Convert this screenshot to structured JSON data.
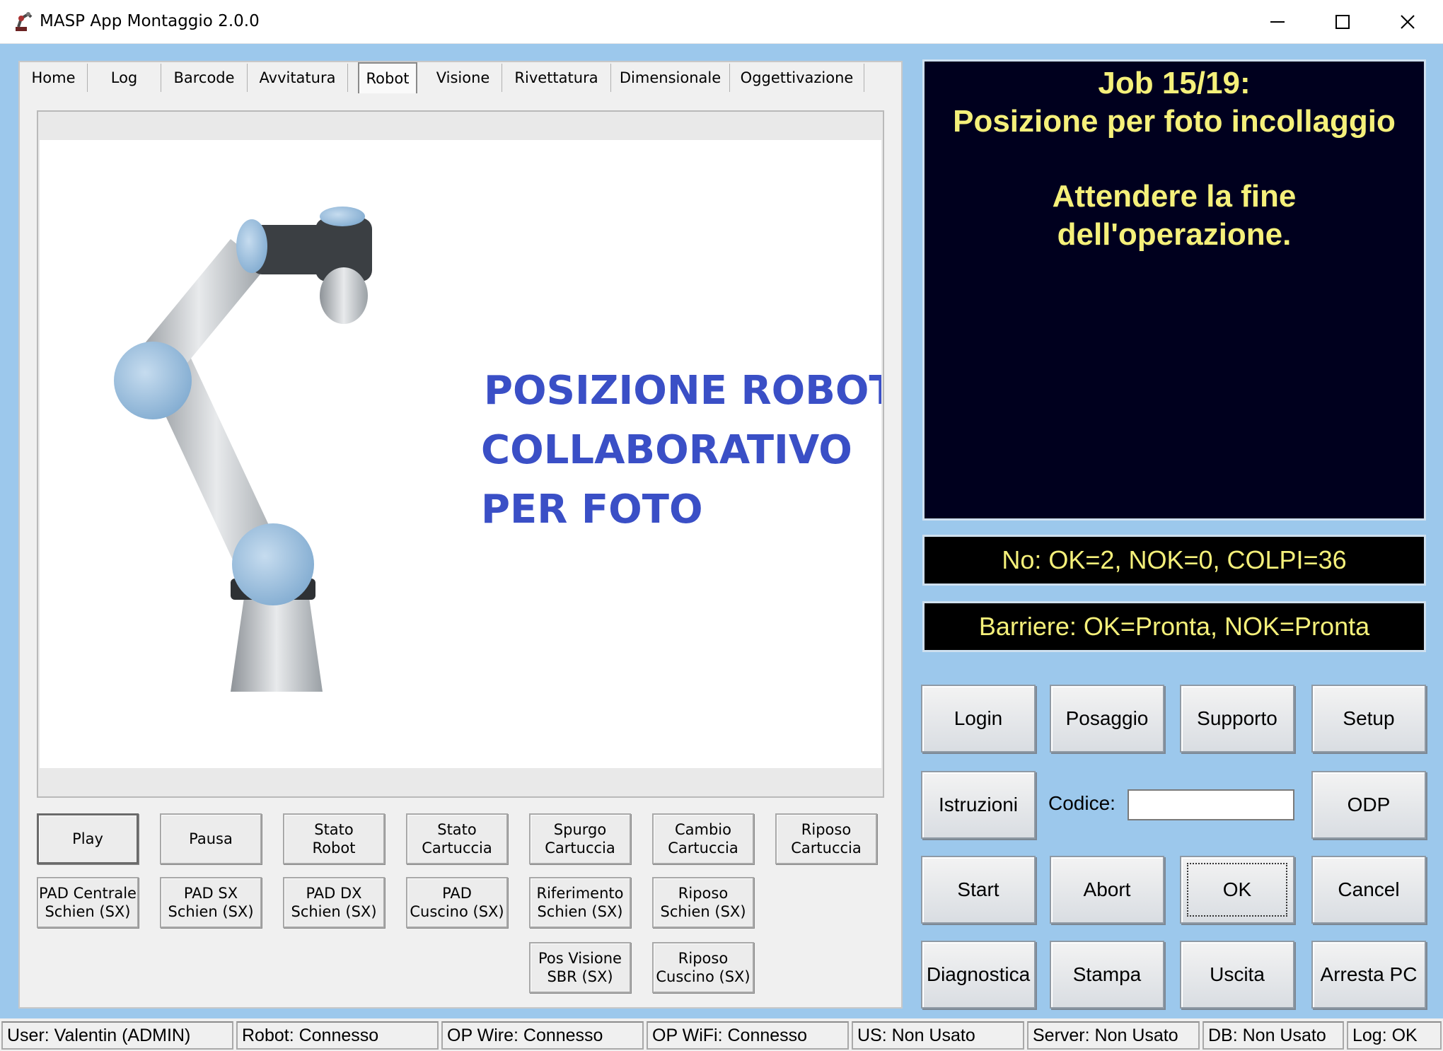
{
  "window": {
    "title": "MASP App Montaggio 2.0.0",
    "app_icon": "robot-arm-icon",
    "controls": [
      "minimize-icon",
      "maximize-icon",
      "close-icon"
    ]
  },
  "tabs": [
    {
      "label": "Home",
      "active": false
    },
    {
      "label": "Log",
      "active": false
    },
    {
      "label": "Barcode",
      "active": false
    },
    {
      "label": "Avvitatura",
      "active": false
    },
    {
      "label": "Robot",
      "active": true
    },
    {
      "label": "Visione",
      "active": false
    },
    {
      "label": "Rivettatura",
      "active": false
    },
    {
      "label": "Dimensionale",
      "active": false
    },
    {
      "label": "Oggettivazione",
      "active": false
    }
  ],
  "robot_image": {
    "text_lines": [
      "POSIZIONE ROBOT",
      "COLLABORATIVO",
      "PER FOTO"
    ]
  },
  "robot_buttons": [
    {
      "label": "Play"
    },
    {
      "label": "Pausa"
    },
    {
      "label": "Stato\nRobot"
    },
    {
      "label": "Stato\nCartuccia"
    },
    {
      "label": "Spurgo\nCartuccia"
    },
    {
      "label": "Cambio\nCartuccia"
    },
    {
      "label": "Riposo\nCartuccia"
    },
    {
      "label": "PAD Centrale\nSchien (SX)"
    },
    {
      "label": "PAD SX\nSchien (SX)"
    },
    {
      "label": "PAD DX\nSchien (SX)"
    },
    {
      "label": "PAD\nCuscino (SX)"
    },
    {
      "label": "Riferimento\nSchien (SX)"
    },
    {
      "label": "Riposo\nSchien (SX)"
    },
    {
      "label": "Pos Visione\nSBR (SX)"
    },
    {
      "label": "Riposo\nCuscino (SX)"
    }
  ],
  "job_panel": {
    "title": "Job 15/19:",
    "step": "Posizione per foto incollaggio",
    "message_line1": "Attendere la fine",
    "message_line2": "dell'operazione."
  },
  "counters": "No: OK=2, NOK=0, COLPI=36",
  "barriers": "Barriere: OK=Pronta, NOK=Pronta",
  "control_buttons": {
    "login": "Login",
    "posaggio": "Posaggio",
    "supporto": "Supporto",
    "setup": "Setup",
    "istruzioni": "Istruzioni",
    "odp": "ODP",
    "start": "Start",
    "abort": "Abort",
    "ok": "OK",
    "cancel": "Cancel",
    "diagnostica": "Diagnostica",
    "stampa": "Stampa",
    "uscita": "Uscita",
    "arresta_pc": "Arresta PC"
  },
  "codice": {
    "label": "Codice:",
    "value": ""
  },
  "status_bar": [
    "User: Valentin (ADMIN)",
    "Robot: Connesso",
    "OP Wire: Connesso",
    "OP WiFi: Connesso",
    "US: Non Usato",
    "Server: Non Usato",
    "DB: Non Usato",
    "Log: OK"
  ],
  "colors": {
    "client_background": "#9cc8ec",
    "job_panel_background": "#00001e",
    "job_text": "#f5f07a",
    "robot_text": "#3a4fc6"
  }
}
